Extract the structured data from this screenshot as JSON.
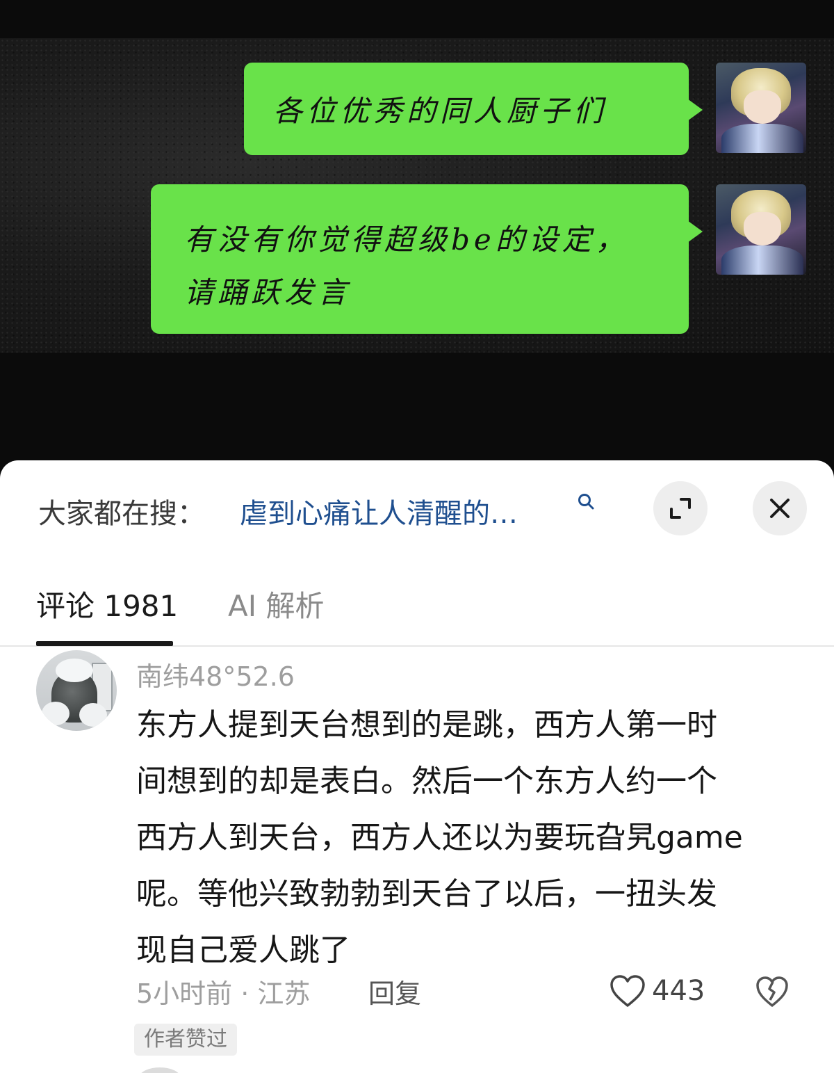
{
  "video": {
    "bubble_1": "各位优秀的同人厨子们",
    "bubble_2_line_1": "有没有你觉得超级be的设定，",
    "bubble_2_line_2": "请踊跃发言"
  },
  "search": {
    "prefix": "大家都在搜：",
    "query": "虐到心痛让人清醒的…",
    "icons": [
      "search-icon",
      "expand-icon",
      "close-icon"
    ]
  },
  "tabs": [
    {
      "label": "评论 1981",
      "active": true
    },
    {
      "label": "AI 解析",
      "active": false
    }
  ],
  "comment": {
    "username": "南纬48°52.6",
    "lines": [
      "东方人提到天台想到的是跳，西方人第一时",
      "间想到的却是表白。然后一个东方人约一个",
      "西方人到天台，西方人还以为要玩旮旯game",
      "呢。等他兴致勃勃到天台了以后，一扭头发",
      "现自己爱人跳了"
    ],
    "meta": "5小时前 · 江苏",
    "reply_label": "回复",
    "like_count": "443",
    "badge": "作者赞过",
    "icons": [
      "heart-icon",
      "broken-heart-icon"
    ]
  },
  "colors": {
    "bubble": "#69e24a",
    "link": "#1f4f8f",
    "muted": "#9e9e9e"
  }
}
